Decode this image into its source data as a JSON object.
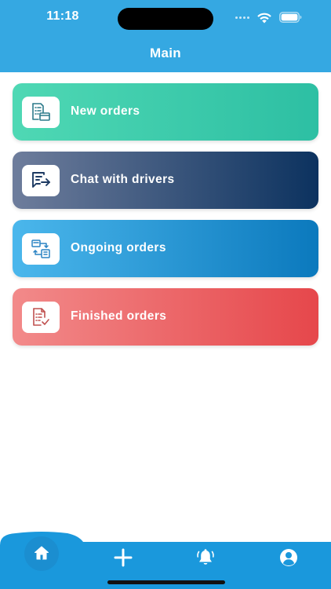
{
  "status_bar": {
    "time": "11:18"
  },
  "header": {
    "title": "Main"
  },
  "menu": {
    "items": [
      {
        "label": "New orders",
        "icon": "new-orders-icon",
        "color_start": "#4fd8b4",
        "color_end": "#2dbfa3"
      },
      {
        "label": "Chat with drivers",
        "icon": "chat-drivers-icon",
        "color_start": "#6e7d9c",
        "color_end": "#0c325f"
      },
      {
        "label": "Ongoing orders",
        "icon": "ongoing-orders-icon",
        "color_start": "#4bb7ec",
        "color_end": "#0b79bd"
      },
      {
        "label": "Finished orders",
        "icon": "finished-orders-icon",
        "color_start": "#f28a8a",
        "color_end": "#e6474b"
      }
    ]
  },
  "tab_bar": {
    "active_tab": "home",
    "tabs": [
      {
        "id": "home",
        "icon": "home-icon"
      },
      {
        "id": "add",
        "icon": "plus-icon"
      },
      {
        "id": "notifications",
        "icon": "bell-icon"
      },
      {
        "id": "profile",
        "icon": "user-icon"
      }
    ]
  },
  "colors": {
    "header": "#35a8e2",
    "tab_bar": "#1a98dc",
    "active_tab": "#1b8ed0",
    "background": "#ffffff"
  }
}
